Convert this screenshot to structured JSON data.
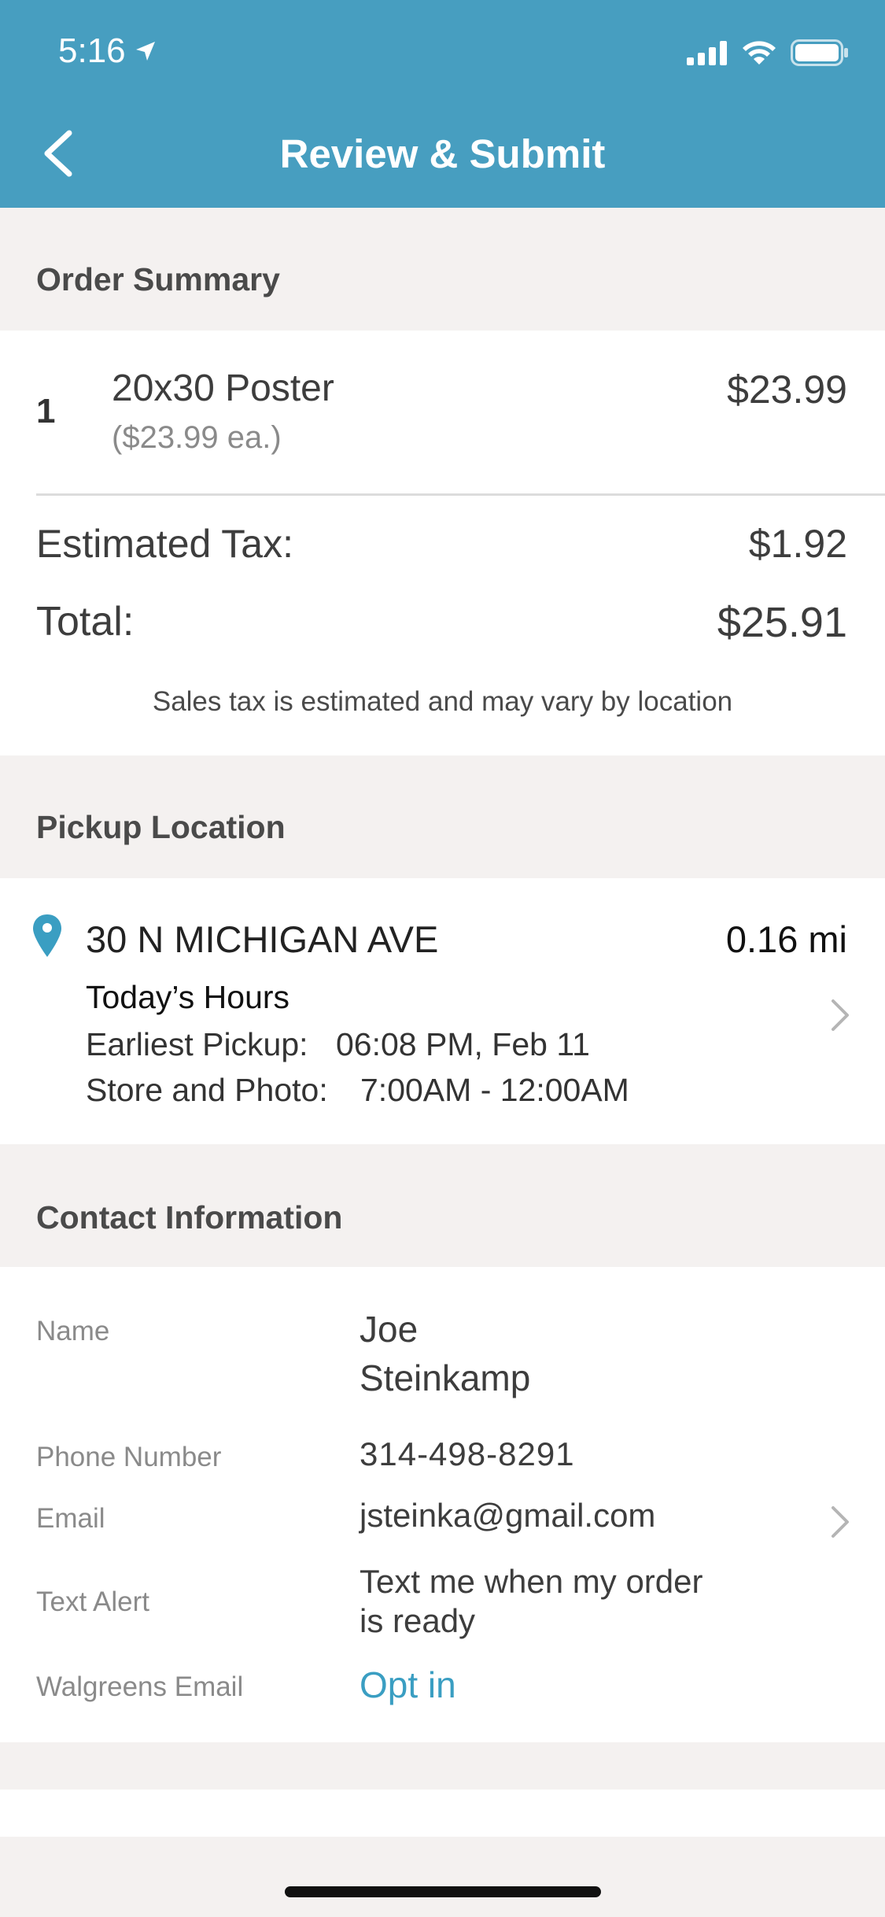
{
  "status": {
    "time": "5:16"
  },
  "nav": {
    "title": "Review & Submit"
  },
  "order_summary": {
    "heading": "Order Summary",
    "item": {
      "qty": "1",
      "name": "20x30 Poster",
      "unit_price": "($23.99 ea.)",
      "price": "$23.99"
    },
    "tax_label": "Estimated Tax:",
    "tax_value": "$1.92",
    "total_label": "Total:",
    "total_value": "$25.91",
    "note": "Sales tax is estimated and may vary by location"
  },
  "pickup": {
    "heading": "Pickup Location",
    "address": "30 N MICHIGAN AVE",
    "distance": "0.16 mi",
    "hours_title": "Today’s Hours",
    "earliest_label": "Earliest Pickup:",
    "earliest_value": "06:08 PM, Feb 11",
    "store_label": "Store and Photo:",
    "store_value": "7:00AM - 12:00AM"
  },
  "contact": {
    "heading": "Contact Information",
    "name_label": "Name",
    "first_name": "Joe",
    "last_name": "Steinkamp",
    "phone_label": "Phone Number",
    "phone_value": "314-498-8291",
    "email_label": "Email",
    "email_value": "jsteinka@gmail.com",
    "text_label": "Text Alert",
    "text_line1": "Text me when my order",
    "text_line2": "is ready",
    "walgreens_label": "Walgreens Email",
    "walgreens_value": "Opt in"
  },
  "colors": {
    "header": "#479ec0",
    "accent": "#3a9ec2",
    "page_bg": "#f4f1f0"
  }
}
